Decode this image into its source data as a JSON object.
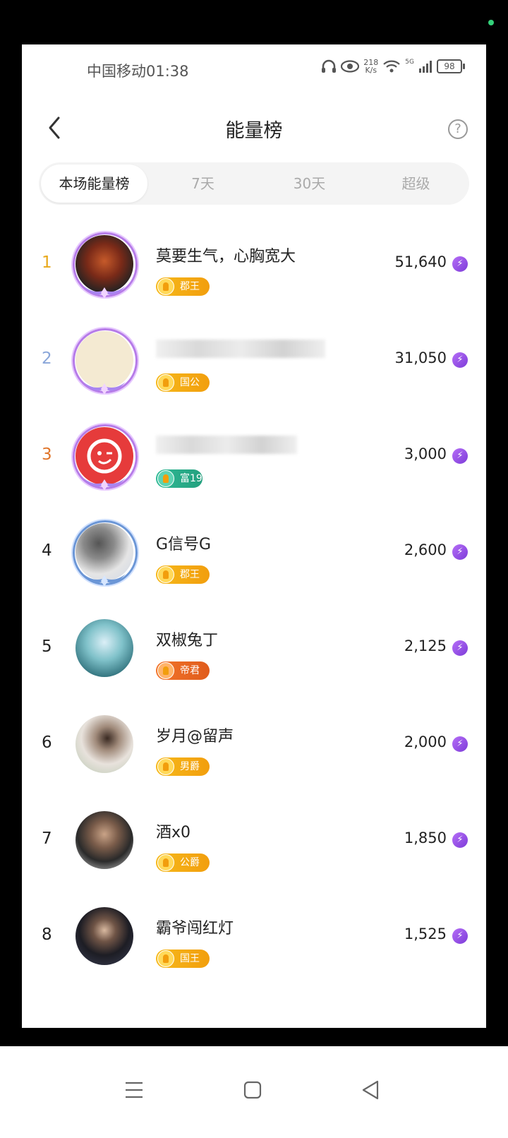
{
  "status_bar": {
    "carrier_time": "中国移动01:38",
    "speed_value": "218",
    "speed_unit": "K/s",
    "network": "5G",
    "battery": "98"
  },
  "header": {
    "title": "能量榜",
    "help_icon": "question-circle-icon",
    "back_icon": "chevron-left-icon"
  },
  "tabs": [
    {
      "label": "本场能量榜",
      "active": true
    },
    {
      "label": "7天"
    },
    {
      "label": "30天"
    },
    {
      "label": "超级"
    }
  ],
  "ranking": [
    {
      "rank": "1",
      "name": "莫要生气，心胸宽大",
      "badge": "郡王",
      "score": "51,640"
    },
    {
      "rank": "2",
      "name": "",
      "badge": "国公",
      "score": "31,050"
    },
    {
      "rank": "3",
      "name": "",
      "badge": "富19",
      "score": "3,000"
    },
    {
      "rank": "4",
      "name": "G信号G",
      "badge": "郡王",
      "score": "2,600"
    },
    {
      "rank": "5",
      "name": "双椒兔丁",
      "badge": "帝君",
      "score": "2,125"
    },
    {
      "rank": "6",
      "name": "岁月@留声",
      "badge": "男爵",
      "score": "2,000"
    },
    {
      "rank": "7",
      "name": "酒x0",
      "badge": "公爵",
      "score": "1,850"
    },
    {
      "rank": "8",
      "name": "霸爷闯红灯",
      "badge": "国王",
      "score": "1,525"
    }
  ],
  "colors": {
    "accent_purple": "#8b45e0",
    "gold": "#f4b01a",
    "rank1": "#e8a91b",
    "rank2": "#8aa6d9",
    "rank3": "#e0752a"
  }
}
